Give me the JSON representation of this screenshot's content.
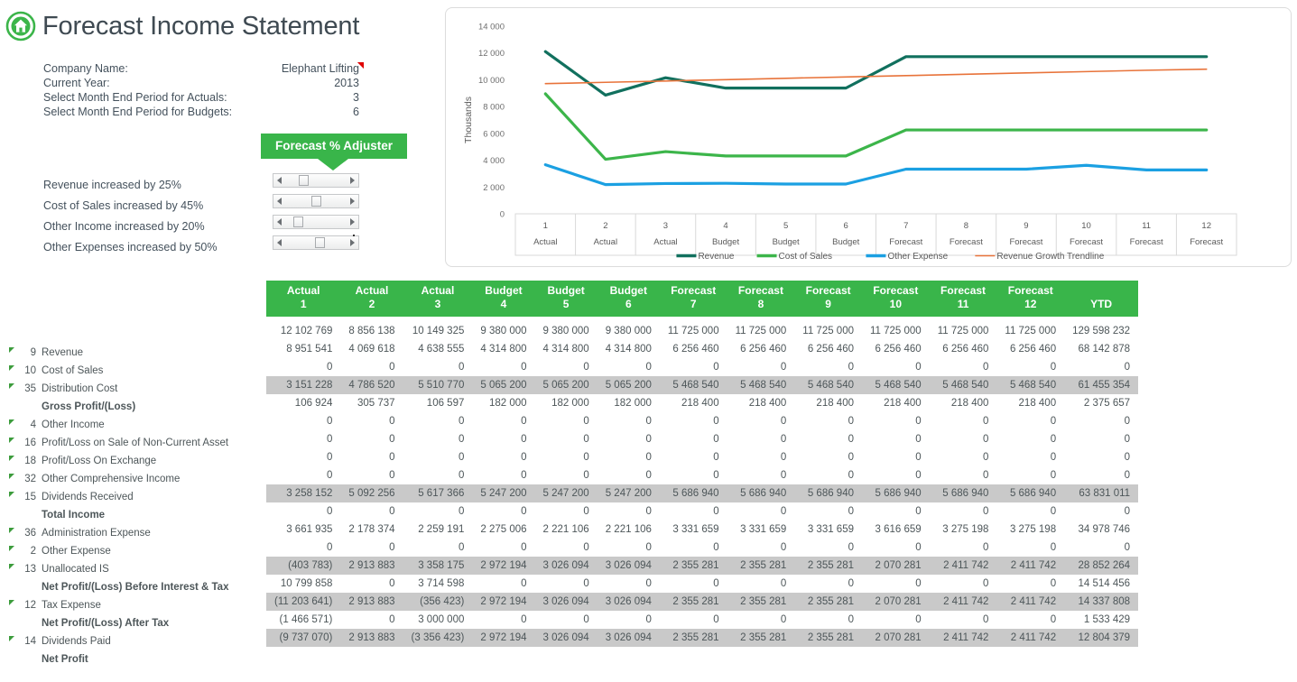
{
  "header": {
    "title": "Forecast Income Statement",
    "logo_icon": "home-icon"
  },
  "info": {
    "rows": [
      {
        "label": "Company Name:",
        "value": "Elephant Lifting",
        "flag": false
      },
      {
        "label": "Current Year:",
        "value": "2013",
        "flag": false
      },
      {
        "label": "Select Month End Period for Actuals:",
        "value": "3",
        "flag": true
      },
      {
        "label": "Select Month End Period for Budgets:",
        "value": "6",
        "flag": true
      }
    ]
  },
  "adjuster": {
    "banner_label": "Forecast % Adjuster",
    "accent_color": "#39b54a",
    "items": [
      {
        "label": "Revenue increased by 25%",
        "percent": 25,
        "thumb_pos": 28
      },
      {
        "label": "Cost of Sales increased by 45%",
        "percent": 45,
        "thumb_pos": 42
      },
      {
        "label": "Other Income increased by 20%",
        "percent": 20,
        "thumb_pos": 22
      },
      {
        "label": "Other Expenses increased by 50%",
        "percent": 50,
        "thumb_pos": 46
      }
    ]
  },
  "chart_data": {
    "type": "line",
    "title": "",
    "xlabel": "",
    "ylabel": "Thousands",
    "ylim": [
      0,
      14000
    ],
    "yticks": [
      0,
      2000,
      4000,
      6000,
      8000,
      10000,
      12000,
      14000
    ],
    "ytick_labels": [
      "0",
      "2 000",
      "4 000",
      "6 000",
      "8 000",
      "10 000",
      "12 000",
      "14 000"
    ],
    "grid": false,
    "legend_position": "bottom",
    "categories": [
      "1",
      "2",
      "3",
      "4",
      "5",
      "6",
      "7",
      "8",
      "9",
      "10",
      "11",
      "12"
    ],
    "category_types": [
      "Actual",
      "Actual",
      "Actual",
      "Budget",
      "Budget",
      "Budget",
      "Forecast",
      "Forecast",
      "Forecast",
      "Forecast",
      "Forecast",
      "Forecast"
    ],
    "series": [
      {
        "name": "Revenue",
        "color": "#11705e",
        "values": [
          12103,
          8856,
          10149,
          9380,
          9380,
          9380,
          11725,
          11725,
          11725,
          11725,
          11725,
          11725
        ]
      },
      {
        "name": "Cost of Sales",
        "color": "#3cb54a",
        "values": [
          8952,
          4070,
          4639,
          4315,
          4315,
          4315,
          6256,
          6256,
          6256,
          6256,
          6256,
          6256
        ]
      },
      {
        "name": "Other Expense",
        "color": "#1ba0e2",
        "values": [
          3662,
          2178,
          2259,
          2275,
          2221,
          2221,
          3332,
          3332,
          3332,
          3617,
          3275,
          3275
        ]
      },
      {
        "name": "Revenue Growth Trendline",
        "color": "#e8733a",
        "values": [
          9710,
          9810,
          9910,
          10010,
          10110,
          10210,
          10310,
          10410,
          10510,
          10610,
          10710,
          10790
        ]
      }
    ]
  },
  "table": {
    "columns": [
      {
        "type": "Actual",
        "num": "1"
      },
      {
        "type": "Actual",
        "num": "2"
      },
      {
        "type": "Actual",
        "num": "3"
      },
      {
        "type": "Budget",
        "num": "4"
      },
      {
        "type": "Budget",
        "num": "5"
      },
      {
        "type": "Budget",
        "num": "6"
      },
      {
        "type": "Forecast",
        "num": "7"
      },
      {
        "type": "Forecast",
        "num": "8"
      },
      {
        "type": "Forecast",
        "num": "9"
      },
      {
        "type": "Forecast",
        "num": "10"
      },
      {
        "type": "Forecast",
        "num": "11"
      },
      {
        "type": "Forecast",
        "num": "12"
      },
      {
        "type": "",
        "num": "YTD"
      }
    ],
    "rows": [
      {
        "code": "9",
        "label": "Revenue",
        "bold": false,
        "subtotal": false,
        "values": [
          "12 102 769",
          "8 856 138",
          "10 149 325",
          "9 380 000",
          "9 380 000",
          "9 380 000",
          "11 725 000",
          "11 725 000",
          "11 725 000",
          "11 725 000",
          "11 725 000",
          "11 725 000",
          "129 598 232"
        ]
      },
      {
        "code": "10",
        "label": "Cost of Sales",
        "bold": false,
        "subtotal": false,
        "values": [
          "8 951 541",
          "4 069 618",
          "4 638 555",
          "4 314 800",
          "4 314 800",
          "4 314 800",
          "6 256 460",
          "6 256 460",
          "6 256 460",
          "6 256 460",
          "6 256 460",
          "6 256 460",
          "68 142 878"
        ]
      },
      {
        "code": "35",
        "label": "Distribution Cost",
        "bold": false,
        "subtotal": false,
        "values": [
          "0",
          "0",
          "0",
          "0",
          "0",
          "0",
          "0",
          "0",
          "0",
          "0",
          "0",
          "0",
          "0"
        ]
      },
      {
        "code": "",
        "label": "Gross Profit/(Loss)",
        "bold": true,
        "subtotal": true,
        "values": [
          "3 151 228",
          "4 786 520",
          "5 510 770",
          "5 065 200",
          "5 065 200",
          "5 065 200",
          "5 468 540",
          "5 468 540",
          "5 468 540",
          "5 468 540",
          "5 468 540",
          "5 468 540",
          "61 455 354"
        ]
      },
      {
        "code": "4",
        "label": "Other Income",
        "bold": false,
        "subtotal": false,
        "values": [
          "106 924",
          "305 737",
          "106 597",
          "182 000",
          "182 000",
          "182 000",
          "218 400",
          "218 400",
          "218 400",
          "218 400",
          "218 400",
          "218 400",
          "2 375 657"
        ]
      },
      {
        "code": "16",
        "label": "Profit/Loss on Sale of Non-Current Asset",
        "bold": false,
        "subtotal": false,
        "values": [
          "0",
          "0",
          "0",
          "0",
          "0",
          "0",
          "0",
          "0",
          "0",
          "0",
          "0",
          "0",
          "0"
        ]
      },
      {
        "code": "18",
        "label": "Profit/Loss On Exchange",
        "bold": false,
        "subtotal": false,
        "values": [
          "0",
          "0",
          "0",
          "0",
          "0",
          "0",
          "0",
          "0",
          "0",
          "0",
          "0",
          "0",
          "0"
        ]
      },
      {
        "code": "32",
        "label": "Other Comprehensive Income",
        "bold": false,
        "subtotal": false,
        "values": [
          "0",
          "0",
          "0",
          "0",
          "0",
          "0",
          "0",
          "0",
          "0",
          "0",
          "0",
          "0",
          "0"
        ]
      },
      {
        "code": "15",
        "label": "Dividends Received",
        "bold": false,
        "subtotal": false,
        "values": [
          "0",
          "0",
          "0",
          "0",
          "0",
          "0",
          "0",
          "0",
          "0",
          "0",
          "0",
          "0",
          "0"
        ]
      },
      {
        "code": "",
        "label": "Total Income",
        "bold": true,
        "subtotal": true,
        "values": [
          "3 258 152",
          "5 092 256",
          "5 617 366",
          "5 247 200",
          "5 247 200",
          "5 247 200",
          "5 686 940",
          "5 686 940",
          "5 686 940",
          "5 686 940",
          "5 686 940",
          "5 686 940",
          "63 831 011"
        ]
      },
      {
        "code": "36",
        "label": "Administration Expense",
        "bold": false,
        "subtotal": false,
        "values": [
          "0",
          "0",
          "0",
          "0",
          "0",
          "0",
          "0",
          "0",
          "0",
          "0",
          "0",
          "0",
          "0"
        ]
      },
      {
        "code": "2",
        "label": "Other Expense",
        "bold": false,
        "subtotal": false,
        "values": [
          "3 661 935",
          "2 178 374",
          "2 259 191",
          "2 275 006",
          "2 221 106",
          "2 221 106",
          "3 331 659",
          "3 331 659",
          "3 331 659",
          "3 616 659",
          "3 275 198",
          "3 275 198",
          "34 978 746"
        ]
      },
      {
        "code": "13",
        "label": "Unallocated IS",
        "bold": false,
        "subtotal": false,
        "values": [
          "0",
          "0",
          "0",
          "0",
          "0",
          "0",
          "0",
          "0",
          "0",
          "0",
          "0",
          "0",
          "0"
        ]
      },
      {
        "code": "",
        "label": "Net Profit/(Loss) Before Interest & Tax",
        "bold": true,
        "subtotal": true,
        "values": [
          "(403 783)",
          "2 913 883",
          "3 358 175",
          "2 972 194",
          "3 026 094",
          "3 026 094",
          "2 355 281",
          "2 355 281",
          "2 355 281",
          "2 070 281",
          "2 411 742",
          "2 411 742",
          "28 852 264"
        ]
      },
      {
        "code": "12",
        "label": "Tax Expense",
        "bold": false,
        "subtotal": false,
        "values": [
          "10 799 858",
          "0",
          "3 714 598",
          "0",
          "0",
          "0",
          "0",
          "0",
          "0",
          "0",
          "0",
          "0",
          "14 514 456"
        ]
      },
      {
        "code": "",
        "label": "Net Profit/(Loss) After Tax",
        "bold": true,
        "subtotal": true,
        "values": [
          "(11 203 641)",
          "2 913 883",
          "(356 423)",
          "2 972 194",
          "3 026 094",
          "3 026 094",
          "2 355 281",
          "2 355 281",
          "2 355 281",
          "2 070 281",
          "2 411 742",
          "2 411 742",
          "14 337 808"
        ]
      },
      {
        "code": "14",
        "label": "Dividends Paid",
        "bold": false,
        "subtotal": false,
        "values": [
          "(1 466 571)",
          "0",
          "3 000 000",
          "0",
          "0",
          "0",
          "0",
          "0",
          "0",
          "0",
          "0",
          "0",
          "1 533 429"
        ]
      },
      {
        "code": "",
        "label": "Net Profit",
        "bold": true,
        "subtotal": true,
        "values": [
          "(9 737 070)",
          "2 913 883",
          "(3 356 423)",
          "2 972 194",
          "3 026 094",
          "3 026 094",
          "2 355 281",
          "2 355 281",
          "2 355 281",
          "2 070 281",
          "2 411 742",
          "2 411 742",
          "12 804 379"
        ]
      }
    ]
  }
}
